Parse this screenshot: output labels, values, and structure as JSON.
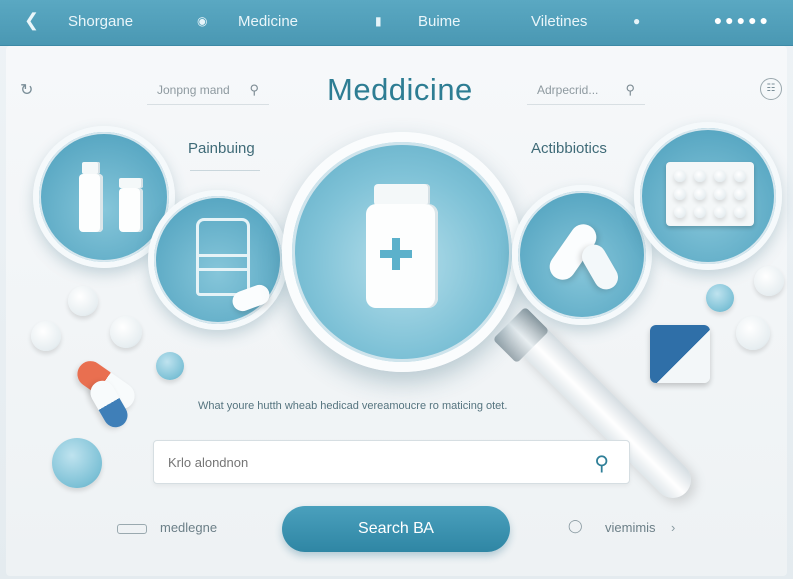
{
  "topbar": {
    "back_icon": "chevron-left-icon",
    "items": [
      "Shorgane",
      "Medicine",
      "Buime",
      "Viletines"
    ],
    "more_icon": "dots-icon"
  },
  "header": {
    "title": "Meddicine",
    "left_search": {
      "placeholder": "Jonpng mand"
    },
    "right_search": {
      "placeholder": "Adrpecrid..."
    }
  },
  "categories": [
    "Painbuing",
    "Actibbiotics"
  ],
  "caption": "What youre hutth wheab hedicad vereamoucre ro maticing otet.",
  "search": {
    "placeholder": "Krlo alondnon"
  },
  "search_button": {
    "label": "Search ВА"
  },
  "footer": {
    "left_link": "medlegne",
    "right_link": "viemimis"
  },
  "colors": {
    "accent": "#2f86a4",
    "topbar": "#4a98b3",
    "title": "#2d7d93",
    "background": "#eef3f6"
  }
}
